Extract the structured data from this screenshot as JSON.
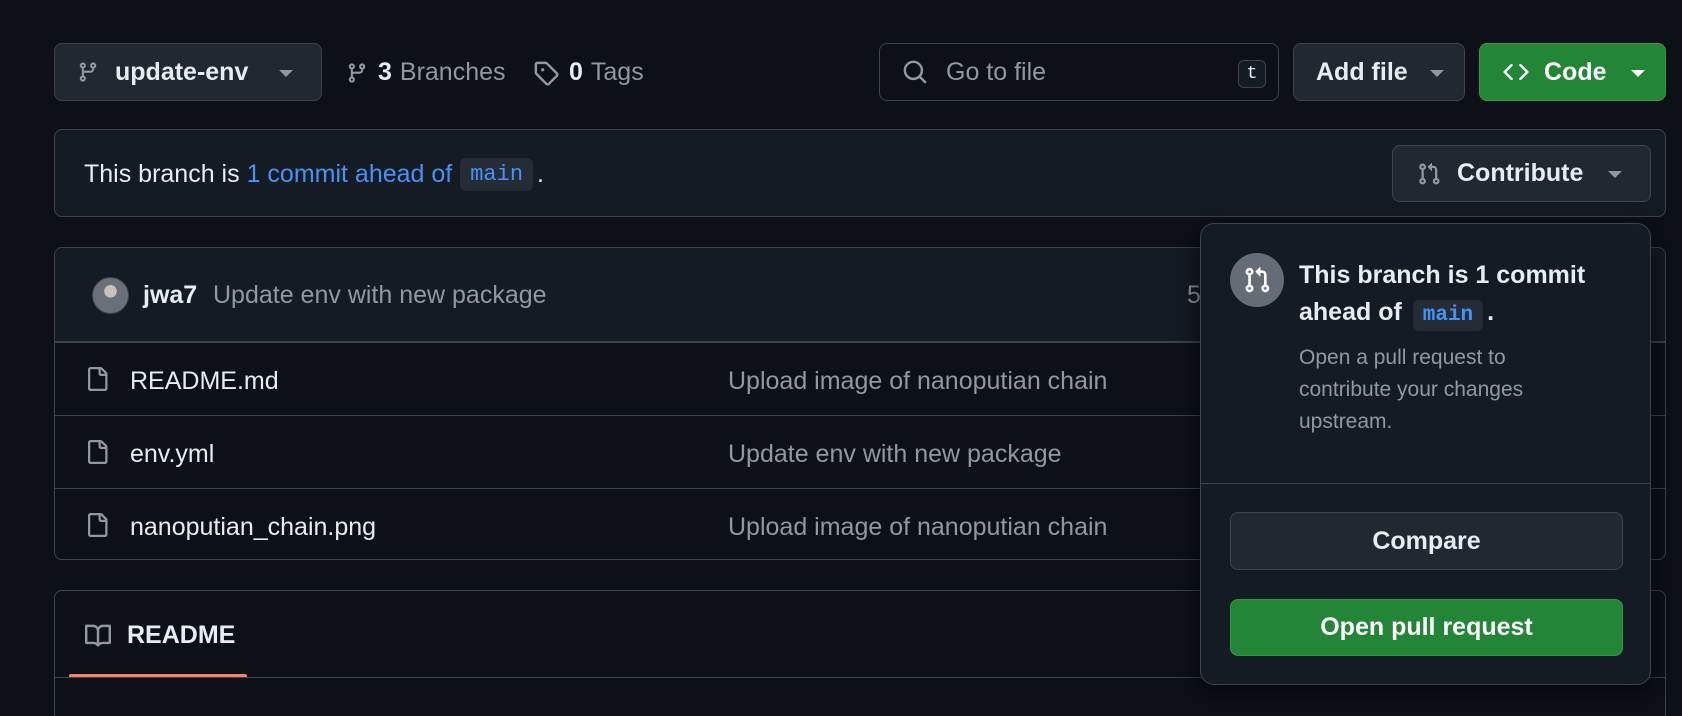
{
  "toolbar": {
    "branch_name": "update-env",
    "branches_count": "3",
    "branches_label": "Branches",
    "tags_count": "0",
    "tags_label": "Tags",
    "search_placeholder": "Go to file",
    "search_shortcut": "t",
    "add_file_label": "Add file",
    "code_label": "Code"
  },
  "banner": {
    "prefix": "This branch is ",
    "link_text": "1 commit ahead of",
    "base_branch": "main",
    "suffix": ".",
    "contribute_label": "Contribute"
  },
  "latest_commit": {
    "author": "jwa7",
    "message": "Update env with new package",
    "time_partial": "5"
  },
  "files": [
    {
      "name": "README.md",
      "message": "Upload image of nanoputian chain"
    },
    {
      "name": "env.yml",
      "message": "Update env with new package"
    },
    {
      "name": "nanoputian_chain.png",
      "message": "Upload image of nanoputian chain"
    }
  ],
  "readme": {
    "tab_label": "README"
  },
  "popover": {
    "title_prefix": "This branch is 1 commit ahead of",
    "title_branch": "main",
    "title_suffix": ".",
    "description": "Open a pull request to contribute your changes upstream.",
    "compare_label": "Compare",
    "open_pr_label": "Open pull request"
  },
  "colors": {
    "background": "#0d1117",
    "accent_link": "#4493f8",
    "primary_green": "#238636",
    "tab_underline": "#f78166"
  }
}
